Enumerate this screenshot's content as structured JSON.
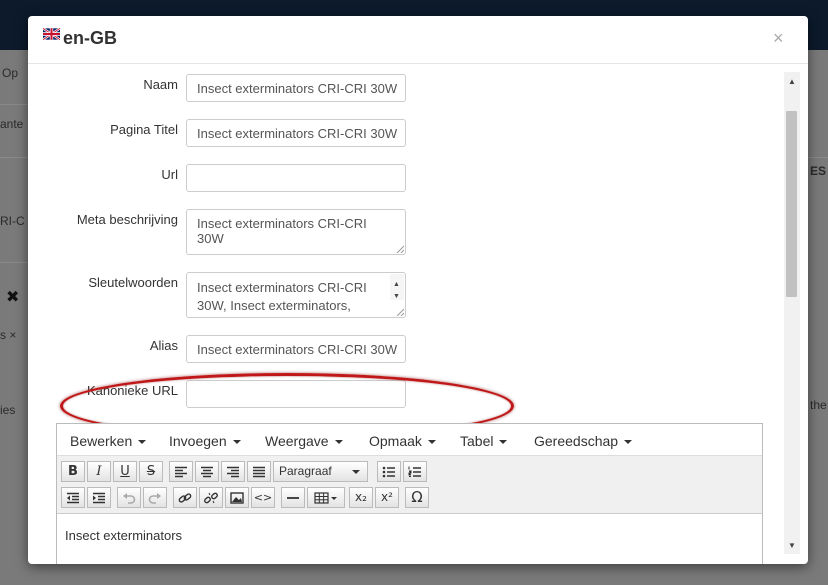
{
  "background": {
    "fragments": [
      "Op",
      "ante",
      "RI-C",
      "✖",
      "s ×",
      "ies",
      "ES",
      "the"
    ]
  },
  "modal": {
    "title": "en-GB",
    "close_glyph": "×",
    "fields": [
      {
        "label": "Naam",
        "value": "Insect exterminators CRI-CRI 30W"
      },
      {
        "label": "Pagina Titel",
        "value": "Insect exterminators CRI-CRI 30W"
      },
      {
        "label": "Url",
        "value": ""
      },
      {
        "label": "Meta beschrijving",
        "value": "Insect exterminators CRI-CRI 30W"
      },
      {
        "label": "Sleutelwoorden",
        "value": "Insect exterminators CRI-CRI 30W,  Insect exterminators,"
      },
      {
        "label": "Alias",
        "value": "Insect exterminators CRI-CRI 30W"
      },
      {
        "label": "Kanonieke URL",
        "value": ""
      }
    ]
  },
  "editor": {
    "menus": [
      "Bewerken",
      "Invoegen",
      "Weergave",
      "Opmaak",
      "Tabel",
      "Gereedschap"
    ],
    "format_select": "Paragraaf",
    "buttons": {
      "bold": "B",
      "italic": "I",
      "underline": "U",
      "strike": "S",
      "subscript": "x₂",
      "superscript": "x²",
      "special_char": "Ω",
      "code": "<>"
    },
    "content": "Insect exterminators"
  },
  "icons": {
    "flag": "flag-uk-icon",
    "align-left": "align-left-icon",
    "align-center": "align-center-icon",
    "align-right": "align-right-icon",
    "justify": "align-justify-icon",
    "bullet-list": "bullet-list-icon",
    "numbered-list": "numbered-list-icon",
    "outdent": "outdent-icon",
    "indent": "indent-icon",
    "undo": "undo-icon",
    "redo": "redo-icon",
    "link": "link-icon",
    "unlink": "unlink-icon",
    "image": "image-icon",
    "hr": "horizontal-rule-icon",
    "table": "table-icon"
  },
  "colors": {
    "highlight": "#c01818",
    "backdrop": "#7a7a7a",
    "topbar": "#0c1a2b"
  }
}
